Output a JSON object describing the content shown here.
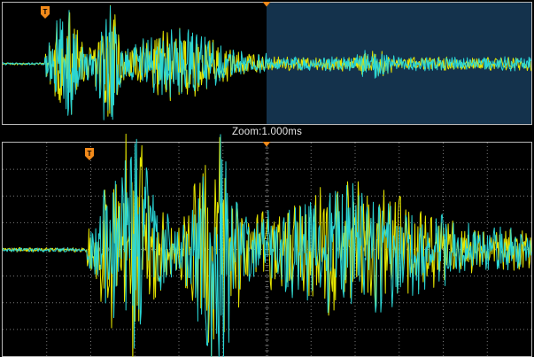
{
  "zoom_label": "Zoom:1.000ms",
  "trigger_marker_label": "T",
  "colors": {
    "background": "#000000",
    "frame": "#b8b8b8",
    "grid": "#7a7a7a",
    "zoom_window": "#14324c",
    "trigger_marker": "#f28a1a",
    "channel_1": "#e6e600",
    "channel_2": "#2ad6d6"
  },
  "icons": [
    "trigger-marker-icon",
    "time-reference-marker-icon"
  ]
}
